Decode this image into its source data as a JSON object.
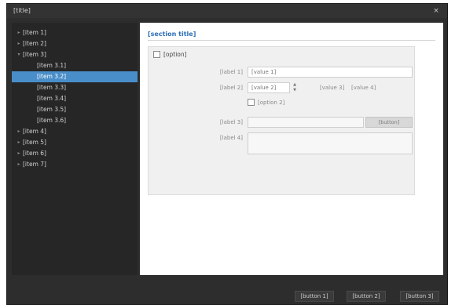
{
  "window": {
    "title": "[title]",
    "close_glyph": "×"
  },
  "sidebar": {
    "items": [
      {
        "label": "[item 1]",
        "level": 1,
        "toggle": "▸"
      },
      {
        "label": "[item 2]",
        "level": 1,
        "toggle": "▸"
      },
      {
        "label": "[item 3]",
        "level": 1,
        "toggle": "▾"
      },
      {
        "label": "[item 3.1]",
        "level": 2,
        "toggle": ""
      },
      {
        "label": "[item 3.2]",
        "level": 2,
        "toggle": "",
        "selected": true
      },
      {
        "label": "[item 3.3]",
        "level": 2,
        "toggle": ""
      },
      {
        "label": "[item 3.4]",
        "level": 2,
        "toggle": ""
      },
      {
        "label": "[item 3.5]",
        "level": 2,
        "toggle": ""
      },
      {
        "label": "[item 3.6]",
        "level": 2,
        "toggle": ""
      },
      {
        "label": "[item 4]",
        "level": 1,
        "toggle": "▸"
      },
      {
        "label": "[item 5]",
        "level": 1,
        "toggle": "▸"
      },
      {
        "label": "[item 6]",
        "level": 1,
        "toggle": "▸"
      },
      {
        "label": "[item 7]",
        "level": 1,
        "toggle": "▸"
      }
    ]
  },
  "content": {
    "section_title": "[section title]",
    "group": {
      "checkbox_label": "[option]",
      "row1_label": "[label 1]",
      "row1_value": "[value 1]",
      "row2_label": "[label 2]",
      "row2_value": "[value 2]",
      "row2_mid": "[value 3]",
      "row2_right": "[value 4]",
      "sub_checkbox_label": "[option 2]",
      "row3_label": "[label 3]",
      "row3_button": "[button]",
      "row4_label": "[label 4]"
    }
  },
  "footer": {
    "ok_label": "[button 1]",
    "cancel_label": "[button 2]",
    "apply_label": "[button 3]"
  },
  "colors": {
    "accent": "#4a8ec9",
    "title_blue": "#2e6fb5",
    "dark_bg": "#2d2d2d"
  }
}
